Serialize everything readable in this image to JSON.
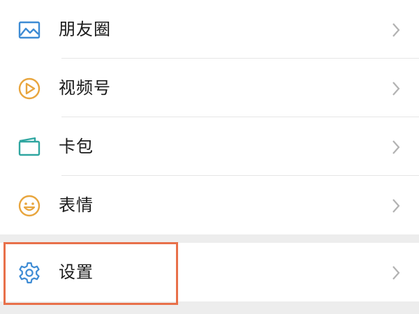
{
  "menu": {
    "items": [
      {
        "label": "朋友圈",
        "icon": "moments-icon",
        "color": "#3d8bd4"
      },
      {
        "label": "视频号",
        "icon": "channels-icon",
        "color": "#e8a53d"
      },
      {
        "label": "卡包",
        "icon": "card-wallet-icon",
        "color": "#2fa6a0"
      },
      {
        "label": "表情",
        "icon": "sticker-smile-icon",
        "color": "#e8a53d"
      }
    ],
    "settings": {
      "label": "设置",
      "icon": "gear-icon",
      "color": "#3d8bd4"
    }
  },
  "colors": {
    "background": "#ededed",
    "row": "#ffffff",
    "text": "#1a1a1a",
    "chevron": "#b2b2b2",
    "highlight": "#e8704a"
  }
}
